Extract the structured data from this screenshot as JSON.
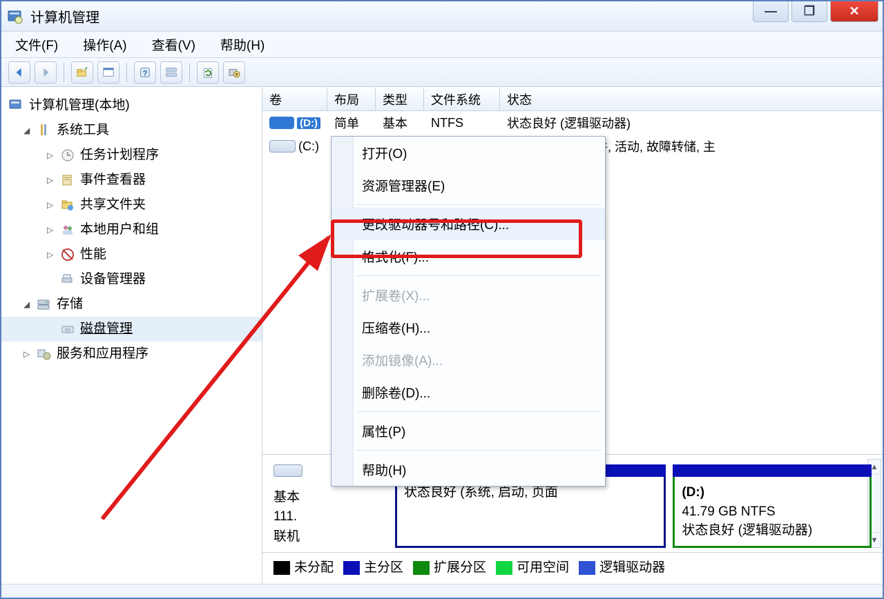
{
  "title": "计算机管理",
  "menu": {
    "file": "文件(F)",
    "action": "操作(A)",
    "view": "查看(V)",
    "help": "帮助(H)"
  },
  "tree": {
    "root": "计算机管理(本地)",
    "system_tools": "系统工具",
    "task_scheduler": "任务计划程序",
    "event_viewer": "事件查看器",
    "shared_folders": "共享文件夹",
    "local_users": "本地用户和组",
    "performance": "性能",
    "device_manager": "设备管理器",
    "storage": "存储",
    "disk_management": "磁盘管理",
    "services_apps": "服务和应用程序"
  },
  "vol_headers": {
    "volume": "卷",
    "layout": "布局",
    "type": "类型",
    "fs": "文件系统",
    "status": "状态"
  },
  "vol_rows": [
    {
      "drive": "(D:)",
      "layout": "简单",
      "type": "基本",
      "fs": "NTFS",
      "status": "状态良好 (逻辑驱动器)"
    },
    {
      "drive": "(C:)",
      "layout": "",
      "type": "",
      "fs": "",
      "status": "统, 启动, 页面文件, 活动, 故障转储, 主"
    }
  ],
  "context_menu": {
    "open": "打开(O)",
    "explorer": "资源管理器(E)",
    "change_letter": "更改驱动器号和路径(C)...",
    "format": "格式化(F)...",
    "extend": "扩展卷(X)...",
    "shrink": "压缩卷(H)...",
    "mirror": "添加镜像(A)...",
    "delete": "删除卷(D)...",
    "properties": "属性(P)",
    "help": "帮助(H)"
  },
  "disk": {
    "type": "基本",
    "size": "111.",
    "status": "联机",
    "part_c": {
      "status": "状态良好 (系统, 启动, 页面"
    },
    "part_d": {
      "name": "(D:)",
      "size": "41.79 GB NTFS",
      "status": "状态良好 (逻辑驱动器)"
    }
  },
  "legend": {
    "unalloc": "未分配",
    "primary": "主分区",
    "extended": "扩展分区",
    "free": "可用空间",
    "logical": "逻辑驱动器"
  }
}
